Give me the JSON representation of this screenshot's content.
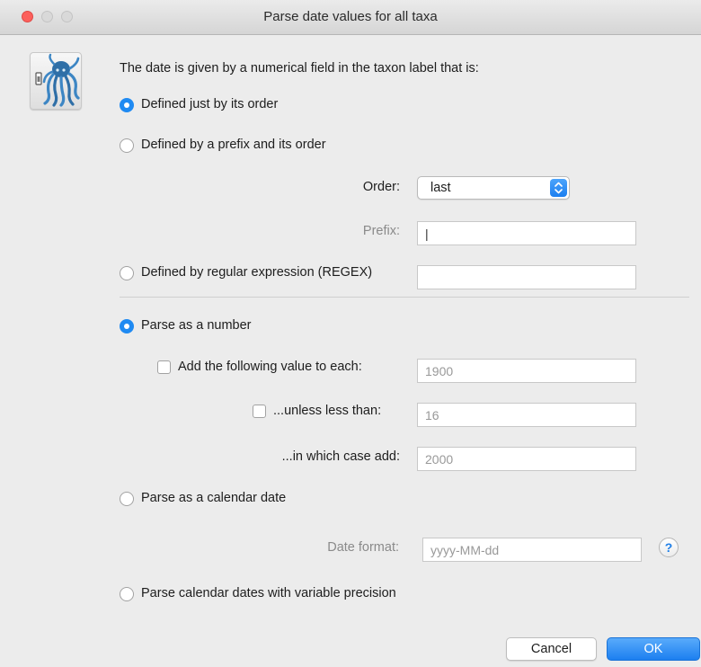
{
  "window": {
    "title": "Parse date values for all taxa"
  },
  "header_text": "The date is given by a numerical field in the taxon label that is:",
  "options": {
    "just_order": "Defined just by its order",
    "prefix_order": "Defined by a prefix and its order",
    "regex": "Defined by regular expression (REGEX)",
    "number": "Parse as a number",
    "calendar": "Parse as a calendar date",
    "variable_precision": "Parse calendar dates with variable precision"
  },
  "order": {
    "label": "Order:",
    "value": "last"
  },
  "prefix": {
    "label": "Prefix:",
    "value": "|"
  },
  "regex_field": {
    "value": ""
  },
  "add_value": {
    "label": "Add the following value to each:",
    "value": "1900",
    "checked": false
  },
  "unless": {
    "label": "...unless less than:",
    "value": "16",
    "checked": false
  },
  "case_add": {
    "label": "...in which case add:",
    "value": "2000"
  },
  "date_format": {
    "label": "Date format:",
    "value": "yyyy-MM-dd"
  },
  "help": {
    "glyph": "?"
  },
  "buttons": {
    "cancel": "Cancel",
    "ok": "OK"
  },
  "icons": [
    "close-icon",
    "minimize-icon",
    "zoom-icon",
    "octopus-app-icon",
    "chevron-updown-icon",
    "help-icon"
  ],
  "colors": {
    "accent": "#1f8af2",
    "close": "#fc605c"
  }
}
